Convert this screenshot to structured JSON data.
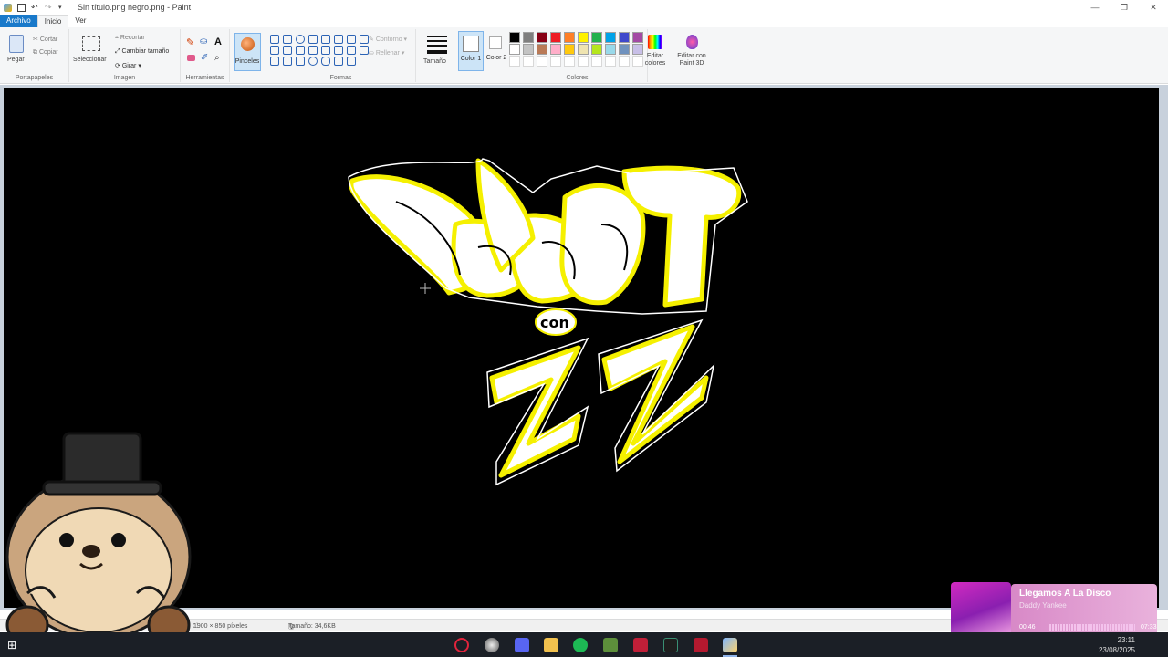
{
  "window": {
    "title": "Sin título.png negro.png - Paint",
    "controls": [
      "—",
      "❐",
      "✕"
    ]
  },
  "tabs": [
    {
      "label": "Archivo"
    },
    {
      "label": "Inicio"
    },
    {
      "label": "Ver"
    }
  ],
  "ribbon": {
    "clipboard": {
      "paste": "Pegar",
      "cut": "Cortar",
      "copy": "Copiar",
      "label": "Portapapeles"
    },
    "image": {
      "select": "Seleccionar",
      "crop": "Recortar",
      "resize": "Cambiar tamaño",
      "rotate": "Girar",
      "label": "Imagen"
    },
    "tools": {
      "label": "Herramientas"
    },
    "brushes": {
      "label": "Pinceles"
    },
    "shapes": {
      "outline": "Contorno",
      "fill": "Rellenar",
      "label": "Formas"
    },
    "size": {
      "label": "Tamaño"
    },
    "color1": {
      "label": "Color 1"
    },
    "color2": {
      "label": "Color 2"
    },
    "colors": {
      "label": "Colores",
      "row1": [
        "#000000",
        "#7f7f7f",
        "#880015",
        "#ed1c24",
        "#ff7f27",
        "#fff200",
        "#22b14c",
        "#00a2e8",
        "#3f48cc",
        "#a349a4"
      ],
      "row2": [
        "#ffffff",
        "#c3c3c3",
        "#b97a57",
        "#ffaec9",
        "#ffc90e",
        "#efe4b0",
        "#b5e61d",
        "#99d9ea",
        "#7092be",
        "#c8bfe7"
      ],
      "row3": [
        "#ffffff",
        "#ffffff",
        "#ffffff",
        "#ffffff",
        "#ffffff",
        "#ffffff",
        "#ffffff",
        "#ffffff",
        "#ffffff",
        "#ffffff"
      ]
    },
    "edit_colors": "Editar colores",
    "paint3d": "Editar con Paint 3D"
  },
  "status": {
    "dimensions": "1900 × 850 píxeles",
    "size": "Tamaño: 34,6KB"
  },
  "nowplaying": {
    "title": "Llegamos A La Disco",
    "artist": "Daddy Yankee",
    "elapsed": "00:46",
    "total": "07:33",
    "progress": 0.1
  },
  "clock": {
    "time": "23:11",
    "date": "23/08/2025"
  }
}
